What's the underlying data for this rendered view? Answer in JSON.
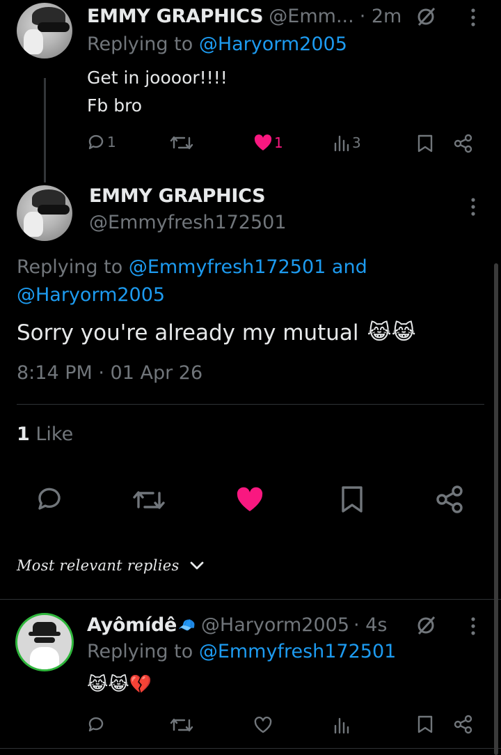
{
  "reply1": {
    "name": "EMMY GRAPHICS",
    "handle": "@Emm...",
    "time": "· 2m",
    "replying_prefix": "Replying to",
    "replying_to": "@Haryorm2005",
    "text_line1": "Get in joooor!!!!",
    "text_line2": "Fb bro",
    "reply_count": "1",
    "like_count": "1",
    "view_count": "3"
  },
  "main": {
    "name": "EMMY GRAPHICS",
    "handle": "@Emmyfresh172501",
    "replying_prefix": "Replying to",
    "replying_to_1": "@Emmyfresh172501",
    "and": "and",
    "replying_to_2": "@Haryorm2005",
    "text": "Sorry you're already my mutual",
    "emoji": "😹😹",
    "timestamp": "8:14 PM · 01 Apr 26",
    "likes_count": "1",
    "likes_label": "Like"
  },
  "sort": {
    "label": "Most relevant replies"
  },
  "reply2": {
    "name": "Ayômídê",
    "name_emoji": "🧢",
    "handle": "@Haryorm2005",
    "time": "· 4s",
    "replying_prefix": "Replying to",
    "replying_to": "@Emmyfresh172501",
    "emoji": "😹😹💔"
  },
  "colors": {
    "background": "#000000",
    "accent": "#1d9bf0",
    "like": "#f91880",
    "muted": "#71767b"
  },
  "icons": [
    "reply-icon",
    "retweet-icon",
    "heart-icon",
    "views-icon",
    "bookmark-icon",
    "share-icon",
    "grok-icon",
    "more-icon",
    "chevron-down-icon"
  ]
}
